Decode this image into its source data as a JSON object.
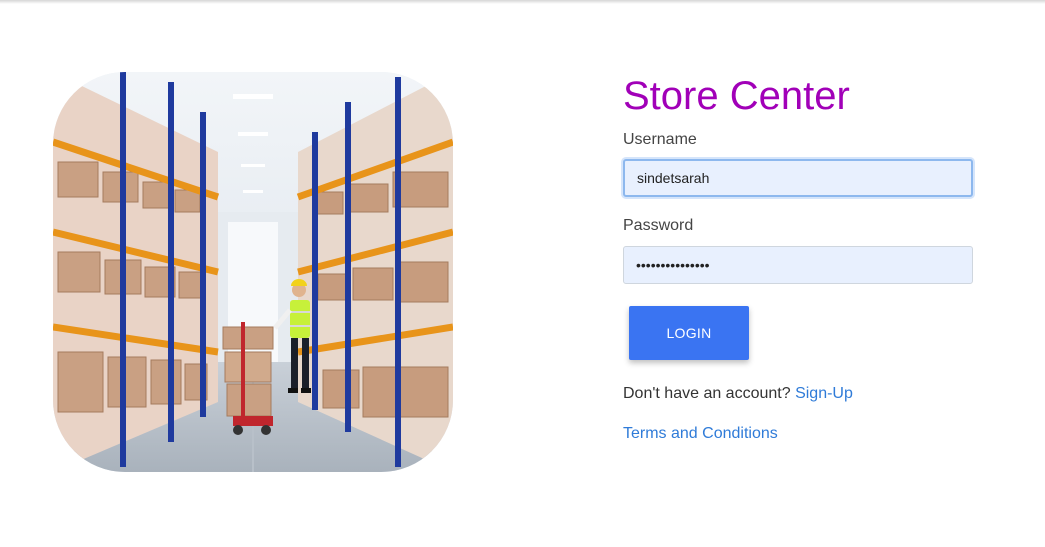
{
  "app": {
    "title": "Store Center"
  },
  "login_form": {
    "username_label": "Username",
    "username_value": "sindetsarah",
    "password_label": "Password",
    "password_value": "•••••••••••••••",
    "login_button_label": "LOGIN",
    "signup_prompt": "Don't have an account?",
    "signup_link_label": "Sign-Up",
    "terms_link_label": "Terms and Conditions"
  },
  "hero_image": {
    "subject": "warehouse-worker-with-pallet-jack"
  },
  "colors": {
    "title": "#a100b8",
    "button": "#3a74f2",
    "link": "#2f7bd8",
    "input_bg": "#e8f0fe"
  }
}
